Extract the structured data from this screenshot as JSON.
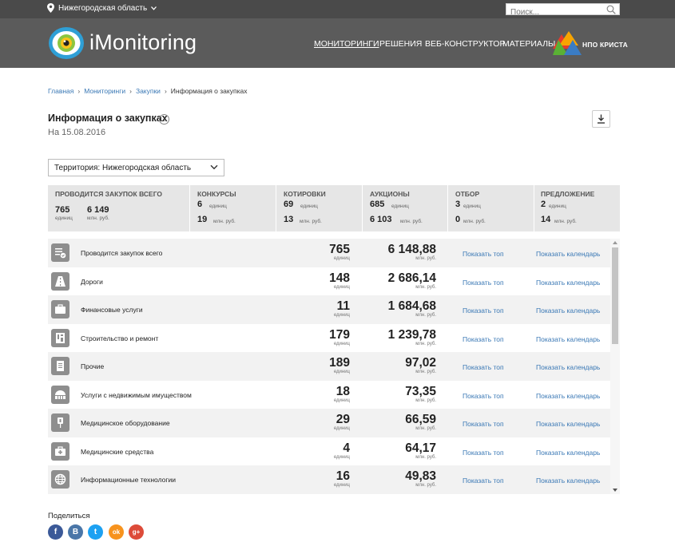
{
  "topbar": {
    "region": "Нижегородская область",
    "search_placeholder": "Поиск..."
  },
  "header": {
    "brand": "iMonitoring",
    "nav": [
      "МОНИТОРИНГИ",
      "РЕШЕНИЯ",
      "ВЕБ-КОНСТРУКТОР",
      "МАТЕРИАЛЫ"
    ],
    "partner": "НПО КРИСТА"
  },
  "breadcrumbs": [
    "Главная",
    "Мониторинги",
    "Закупки",
    "Информация о закупках"
  ],
  "page": {
    "title": "Информация о закупках",
    "info": "i",
    "date": "На 15.08.2016"
  },
  "filter": {
    "territory": "Территория: Нижегородская область"
  },
  "summary": [
    {
      "header": "ПРОВОДИТСЯ ЗАКУПОК ВСЕГО",
      "count": "765",
      "count_unit": "единиц",
      "amount": "6 149",
      "amount_unit": "млн. руб."
    },
    {
      "header": "КОНКУРСЫ",
      "count": "6",
      "count_unit": "единиц",
      "amount": "19",
      "amount_unit": "млн. руб."
    },
    {
      "header": "КОТИРОВКИ",
      "count": "69",
      "count_unit": "единиц",
      "amount": "13",
      "amount_unit": "млн. руб."
    },
    {
      "header": "АУКЦИОНЫ",
      "count": "685",
      "count_unit": "единиц",
      "amount": "6 103",
      "amount_unit": "млн. руб."
    },
    {
      "header": "ОТБОР",
      "count": "3",
      "count_unit": "единиц",
      "amount": "0",
      "amount_unit": "млн. руб."
    },
    {
      "header": "ПРЕДЛОЖЕНИЕ",
      "count": "2",
      "count_unit": "единиц",
      "amount": "14",
      "amount_unit": "млн. руб."
    }
  ],
  "rows": [
    {
      "icon": "checklist-icon",
      "name": "Проводится закупок всего",
      "count": "765",
      "count_unit": "единиц",
      "amount": "6 148,88",
      "amount_unit": "млн. руб.",
      "top": "Показать топ",
      "calendar": "Показать календарь"
    },
    {
      "icon": "road-icon",
      "name": "Дороги",
      "count": "148",
      "count_unit": "единиц",
      "amount": "2 686,14",
      "amount_unit": "млн. руб.",
      "top": "Показать топ",
      "calendar": "Показать календарь"
    },
    {
      "icon": "briefcase-icon",
      "name": "Финансовые услуги",
      "count": "11",
      "count_unit": "единиц",
      "amount": "1 684,68",
      "amount_unit": "млн. руб.",
      "top": "Показать топ",
      "calendar": "Показать календарь"
    },
    {
      "icon": "construction-icon",
      "name": "Строительство и ремонт",
      "count": "179",
      "count_unit": "единиц",
      "amount": "1 239,78",
      "amount_unit": "млн. руб.",
      "top": "Показать топ",
      "calendar": "Показать календарь"
    },
    {
      "icon": "document-icon",
      "name": "Прочие",
      "count": "189",
      "count_unit": "единиц",
      "amount": "97,02",
      "amount_unit": "млн. руб.",
      "top": "Показать топ",
      "calendar": "Показать календарь"
    },
    {
      "icon": "building-icon",
      "name": "Услуги с недвижимым имуществом",
      "count": "18",
      "count_unit": "единиц",
      "amount": "73,35",
      "amount_unit": "млн. руб.",
      "top": "Показать топ",
      "calendar": "Показать календарь"
    },
    {
      "icon": "medical-device-icon",
      "name": "Медицинское оборудование",
      "count": "29",
      "count_unit": "единиц",
      "amount": "66,59",
      "amount_unit": "млн. руб.",
      "top": "Показать топ",
      "calendar": "Показать календарь"
    },
    {
      "icon": "medkit-icon",
      "name": "Медицинские средства",
      "count": "4",
      "count_unit": "единиц",
      "amount": "64,17",
      "amount_unit": "млн. руб.",
      "top": "Показать топ",
      "calendar": "Показать календарь"
    },
    {
      "icon": "globe-icon",
      "name": "Информационные технологии",
      "count": "16",
      "count_unit": "единиц",
      "amount": "49,83",
      "amount_unit": "млн. руб.",
      "top": "Показать топ",
      "calendar": "Показать календарь"
    }
  ],
  "share": {
    "label": "Поделиться",
    "networks": [
      {
        "name": "facebook",
        "glyph": "f",
        "color": "#3b5998"
      },
      {
        "name": "vkontakte",
        "glyph": "B",
        "color": "#4a76a8"
      },
      {
        "name": "twitter",
        "glyph": "t",
        "color": "#1da1f2"
      },
      {
        "name": "odnoklassniki",
        "glyph": "ok",
        "color": "#f7931e"
      },
      {
        "name": "google-plus",
        "glyph": "g+",
        "color": "#dd4b39"
      }
    ]
  }
}
